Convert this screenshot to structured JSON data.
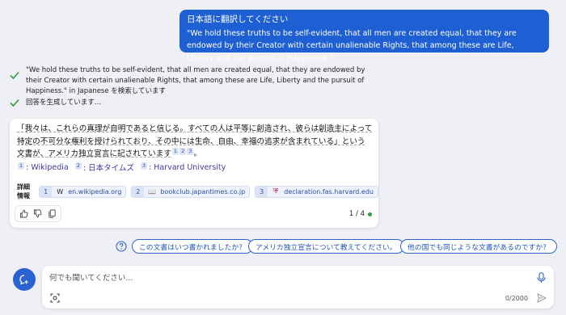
{
  "user_message": {
    "line1": "日本語に翻訳してください",
    "line2": "\"We hold these truths to be self-evident, that all men are created equal, that they are endowed by their Creator with certain unalienable Rights, that among these are Life, Liberty and the pursuit of Happiness.\""
  },
  "status": {
    "search_text": "\"We hold these truths to be self-evident, that all men are created equal, that they are endowed by their Creator with certain unalienable Rights, that among these are Life, Liberty and the pursuit of Happiness.\" in Japanese を検索しています",
    "generating_text": "回答を生成しています…"
  },
  "answer": {
    "part1": "「我々は、これらの真理が自明であると信じる。すべての人は平等に創造され、彼らは創造主によって特定の不可分な権利を授けられており、その中には生命、自由、幸福の追求が含まれている」という文書が、アメリカ独立宣言に記されています",
    "cite1": "1",
    "cite2": "2",
    "cite3": "3",
    "end": "。"
  },
  "references": [
    {
      "num": "1",
      "label": ": Wikipedia"
    },
    {
      "num": "2",
      "label": ": 日本タイムズ"
    },
    {
      "num": "3",
      "label": ": Harvard University"
    }
  ],
  "more_info": {
    "label": "詳細情報",
    "chips": [
      {
        "num": "1",
        "icon": "W",
        "text": "en.wikipedia.org"
      },
      {
        "num": "2",
        "icon": "📖",
        "text": "bookclub.japantimes.co.jp"
      },
      {
        "num": "3",
        "icon": "⛨",
        "text": "declaration.fas.harvard.edu"
      }
    ]
  },
  "pager": {
    "text": "1 / 4"
  },
  "suggestions": [
    "この文書はいつ書かれましたか？",
    "アメリカ独立宣言について教えてください。",
    "他の国でも同じような文書があるのですか？"
  ],
  "input": {
    "placeholder": "何でも聞いてください...",
    "counter": "0/2000"
  },
  "colors": {
    "accent": "#1f5fd4",
    "check": "#2e9c3a",
    "background": "#eef0f6"
  }
}
